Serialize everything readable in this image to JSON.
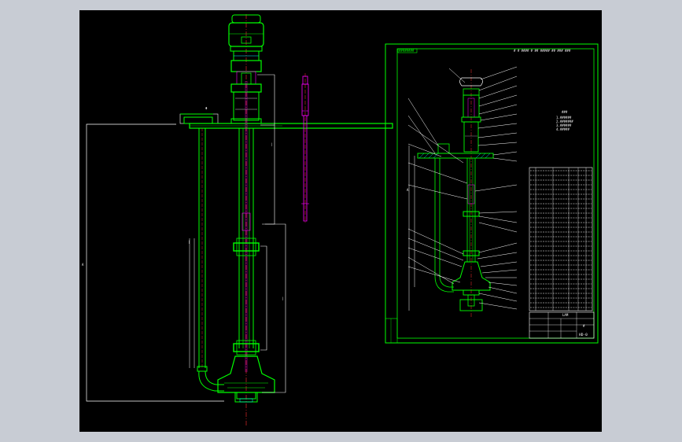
{
  "colors": {
    "background": "#c8ccd4",
    "canvas": "#000000",
    "outline": "#00ff00",
    "dim": "#ffffff",
    "centerline": "#ff3030",
    "detail": "#ff00ff",
    "hatch": "#00ffff",
    "yellow": "#ffff00"
  },
  "sheet": {
    "title_block": {
      "drawing_no": "HD-0",
      "small": "LAM"
    }
  }
}
